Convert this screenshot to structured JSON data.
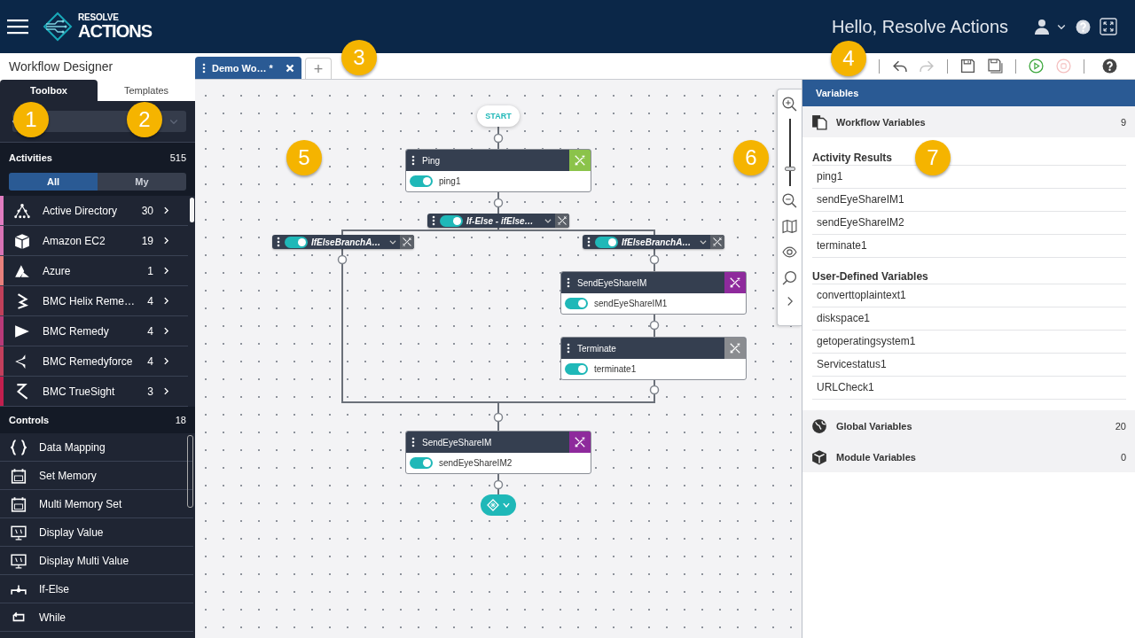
{
  "header": {
    "logo": {
      "line1": "RESOLVE",
      "line2": "ACTIONS"
    },
    "greeting": "Hello, Resolve Actions"
  },
  "page_title": "Workflow Designer",
  "sidebar_tabs": [
    {
      "label": "Toolbox",
      "selected": true
    },
    {
      "label": "Templates",
      "selected": false
    }
  ],
  "activities": {
    "title": "Activities",
    "count": "515",
    "filters": [
      {
        "label": "All",
        "selected": true
      },
      {
        "label": "My",
        "selected": false
      }
    ],
    "items": [
      {
        "name": "Active Directory",
        "count": "30",
        "color": "#e07cc0"
      },
      {
        "name": "Amazon EC2",
        "count": "19",
        "color": "#d873b4"
      },
      {
        "name": "Azure",
        "count": "1",
        "color": "#e8807c"
      },
      {
        "name": "BMC Helix Reme…",
        "count": "4",
        "color": "#c0405a"
      },
      {
        "name": "BMC Remedy",
        "count": "4",
        "color": "#b83a78"
      },
      {
        "name": "BMC Remedyforce",
        "count": "4",
        "color": "#c23f5c"
      },
      {
        "name": "BMC TrueSight",
        "count": "3",
        "color": "#c21f4e"
      }
    ]
  },
  "controls": {
    "title": "Controls",
    "count": "18",
    "items": [
      {
        "name": "Data Mapping"
      },
      {
        "name": "Set Memory"
      },
      {
        "name": "Multi Memory Set"
      },
      {
        "name": "Display Value"
      },
      {
        "name": "Display Multi Value"
      },
      {
        "name": "If-Else"
      },
      {
        "name": "While"
      }
    ]
  },
  "document_tabs": [
    {
      "label": "Demo Wo… *",
      "selected": true
    }
  ],
  "add_tab": "+",
  "toolbar": [
    {
      "kind": "undo",
      "disabled": false
    },
    {
      "kind": "redo",
      "disabled": true
    },
    {
      "kind": "save",
      "disabled": false
    },
    {
      "kind": "save-as",
      "disabled": false
    },
    {
      "kind": "run",
      "disabled": false
    },
    {
      "kind": "stop",
      "disabled": true
    },
    {
      "kind": "help",
      "disabled": false
    }
  ],
  "canvas": {
    "nodes": [
      {
        "kind": "start",
        "label": "START"
      },
      {
        "kind": "activity",
        "title": "Ping",
        "name": "ping1",
        "enabled": true,
        "color": "#8bc34a"
      },
      {
        "kind": "branch",
        "label": "If-Else - ifElse…",
        "enabled": true,
        "color": "#5b6068"
      },
      {
        "kind": "branch",
        "label": "IfElseBranchA…",
        "enabled": true,
        "color": "#5b6068"
      },
      {
        "kind": "branch",
        "label": "IfElseBranchA…",
        "enabled": true,
        "color": "#5b6068"
      },
      {
        "kind": "activity",
        "title": "SendEyeShareIM",
        "name": "sendEyeShareIM1",
        "enabled": true,
        "color": "#8e2a9c"
      },
      {
        "kind": "activity",
        "title": "Terminate",
        "name": "terminate1",
        "enabled": true,
        "color": "#8a8c90"
      },
      {
        "kind": "activity",
        "title": "SendEyeShareIM",
        "name": "sendEyeShareIM2",
        "enabled": true,
        "color": "#8e2a9c"
      },
      {
        "kind": "end"
      }
    ]
  },
  "zoom": {
    "level": 0.22
  },
  "variables": {
    "title": "Variables",
    "sections": [
      {
        "title": "Workflow Variables",
        "count": "9",
        "groups": [
          {
            "title": "Activity Results",
            "items": [
              "ping1",
              "sendEyeShareIM1",
              "sendEyeShareIM2",
              "terminate1"
            ]
          },
          {
            "title": "User-Defined Variables",
            "items": [
              "converttoplaintext1",
              "diskspace1",
              "getoperatingsystem1",
              "Servicestatus1",
              "URLCheck1"
            ]
          }
        ]
      },
      {
        "title": "Global Variables",
        "count": "20"
      },
      {
        "title": "Module Variables",
        "count": "0"
      }
    ]
  },
  "callouts": [
    "1",
    "2",
    "3",
    "4",
    "5",
    "6",
    "7"
  ]
}
